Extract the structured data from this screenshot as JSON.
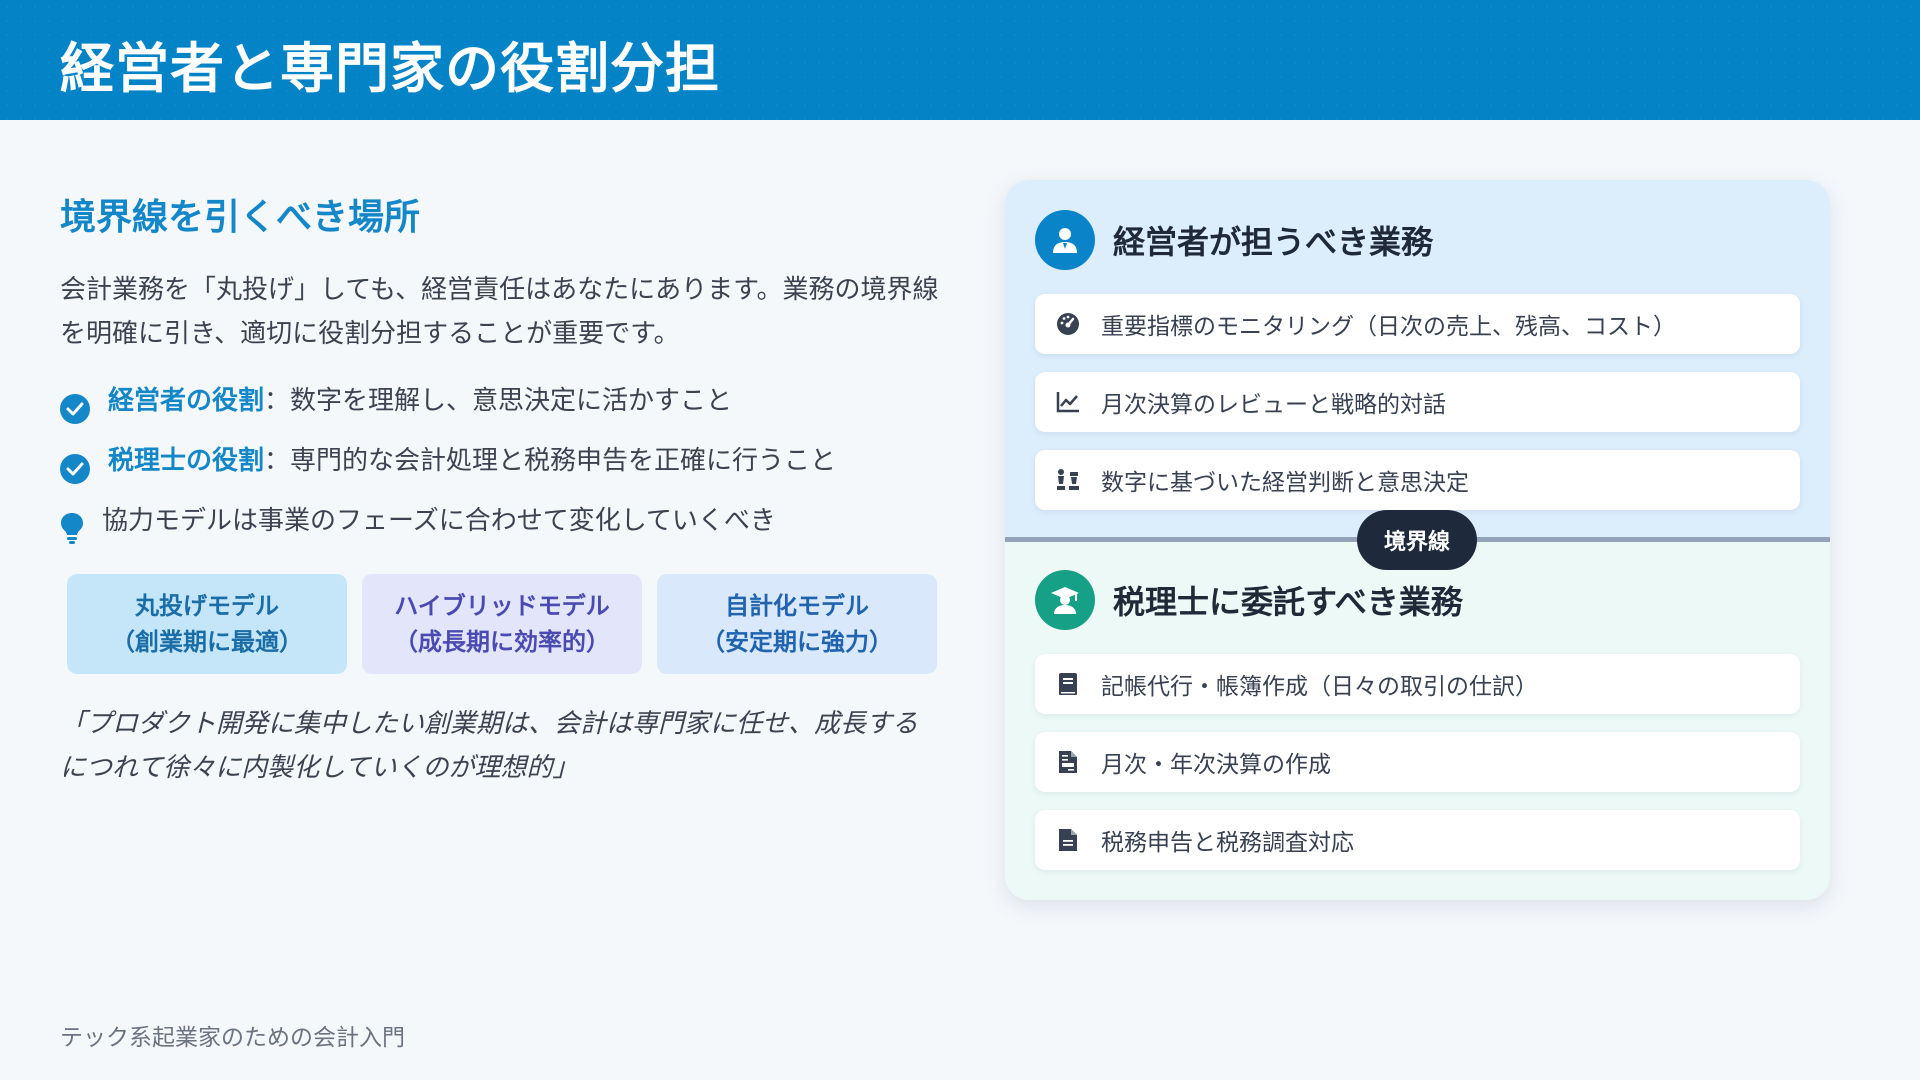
{
  "header": {
    "title": "経営者と専門家の役割分担"
  },
  "left": {
    "section_title": "境界線を引くべき場所",
    "intro": "会計業務を「丸投げ」しても、経営責任はあなたにあります。業務の境界線を明確に引き、適切に役割分担することが重要です。",
    "bullets": [
      {
        "label": "経営者の役割",
        "text": "：数字を理解し、意思決定に活かすこと",
        "icon": "check-circle-icon"
      },
      {
        "label": "税理士の役割",
        "text": "：専門的な会計処理と税務申告を正確に行うこと",
        "icon": "check-circle-icon"
      },
      {
        "text": "協力モデルは事業のフェーズに合わせて変化していくべき",
        "icon": "lightbulb-icon"
      }
    ],
    "models": [
      {
        "name": "丸投げモデル",
        "note": "（創業期に最適）"
      },
      {
        "name": "ハイブリッドモデル",
        "note": "（成長期に効率的）"
      },
      {
        "name": "自計化モデル",
        "note": "（安定期に強力）"
      }
    ],
    "quote": "「プロダクト開発に集中したい創業期は、会計は専門家に任せ、成長するにつれて徐々に内製化していくのが理想的」"
  },
  "panel": {
    "owner": {
      "title": "経営者が担うべき業務",
      "icon": "person-icon",
      "color": "#0a84c8",
      "tasks": [
        {
          "label": "重要指標のモニタリング（日次の売上、残高、コスト）",
          "icon": "gauge-icon"
        },
        {
          "label": "月次決算のレビューと戦略的対話",
          "icon": "line-chart-icon"
        },
        {
          "label": "数字に基づいた経営判断と意思決定",
          "icon": "chess-icon"
        }
      ]
    },
    "divider_label": "境界線",
    "accountant": {
      "title": "税理士に委託すべき業務",
      "icon": "graduate-icon",
      "color": "#16a085",
      "tasks": [
        {
          "label": "記帳代行・帳簿作成（日々の取引の仕訳）",
          "icon": "book-icon"
        },
        {
          "label": "月次・年次決算の作成",
          "icon": "file-invoice-icon"
        },
        {
          "label": "税務申告と税務調査対応",
          "icon": "file-icon"
        }
      ]
    }
  },
  "footer": {
    "text": "テック系起業家のための会計入門"
  }
}
